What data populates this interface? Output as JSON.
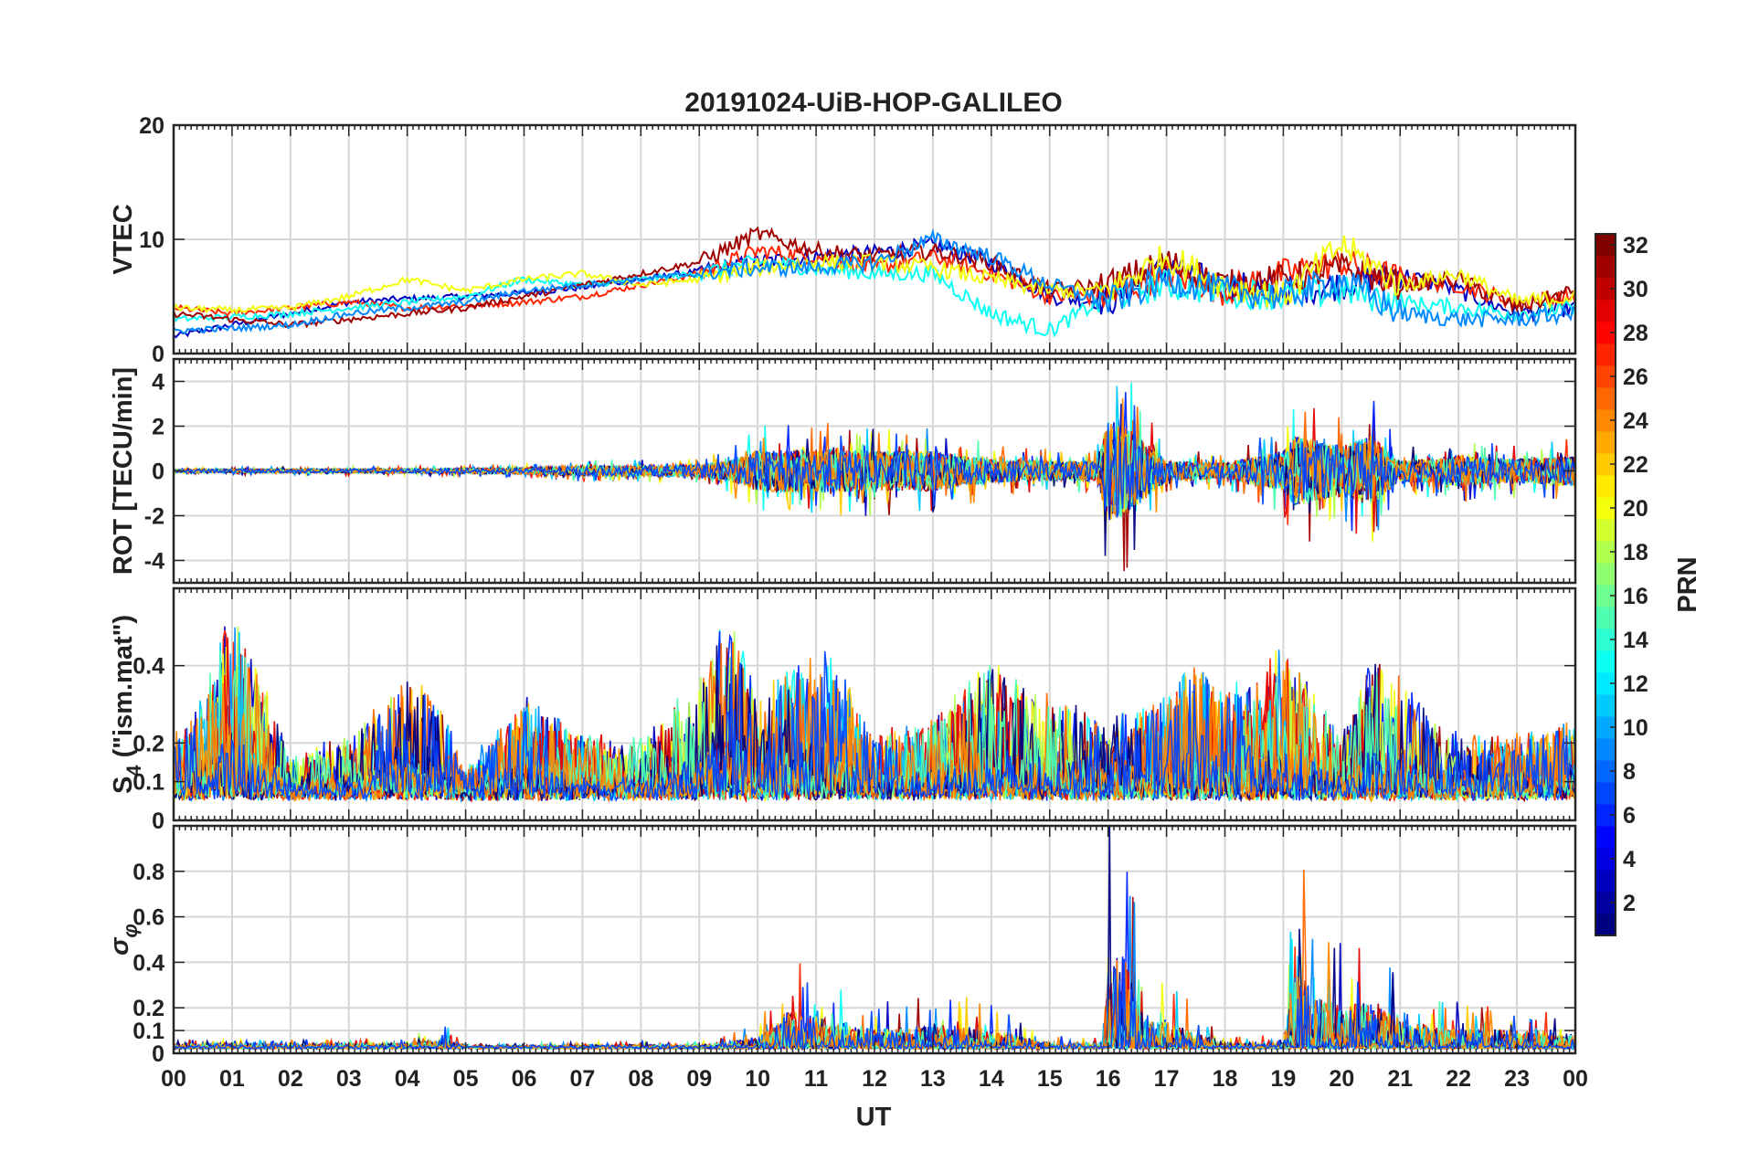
{
  "chart_data": {
    "type": "line",
    "title": "20191024-UiB-HOP-GALILEO",
    "xlabel": "UT",
    "x_ticks": [
      "00",
      "01",
      "02",
      "03",
      "04",
      "05",
      "06",
      "07",
      "08",
      "09",
      "10",
      "11",
      "12",
      "13",
      "14",
      "15",
      "16",
      "17",
      "18",
      "19",
      "20",
      "21",
      "22",
      "23",
      "00"
    ],
    "xlim_hours": [
      0,
      24
    ],
    "grid": true,
    "colorbar": {
      "label": "PRN",
      "range": [
        1,
        32
      ],
      "ticks": [
        "2",
        "4",
        "6",
        "8",
        "10",
        "12",
        "14",
        "16",
        "18",
        "20",
        "22",
        "24",
        "26",
        "28",
        "30",
        "32"
      ],
      "colormap": "jet"
    },
    "panels": [
      {
        "id": "vtec",
        "ylabel": "VTEC",
        "ylim": [
          0,
          20
        ],
        "yticks": [
          "0",
          "10",
          "20"
        ],
        "series": [
          {
            "prn": 3,
            "hours": [
              0,
              1,
              2,
              3,
              4,
              5,
              6,
              7,
              8,
              9,
              10,
              11,
              12,
              13,
              14,
              15,
              16,
              17,
              18,
              19,
              20,
              21,
              22,
              23,
              24
            ],
            "values": [
              1.5,
              2.5,
              3.5,
              4.5,
              4.8,
              5.0,
              5.3,
              5.8,
              6.5,
              7.2,
              8.0,
              8.5,
              8.8,
              9.5,
              8.0,
              5.0,
              4.5,
              7.5,
              6.0,
              5.5,
              6.0,
              7.0,
              5.5,
              3.5,
              4.0
            ]
          },
          {
            "prn": 27,
            "hours": [
              0,
              1,
              2,
              3,
              4,
              5,
              6,
              7,
              8,
              9,
              10,
              11,
              12,
              13,
              14,
              15,
              16,
              17,
              18,
              19,
              20,
              21,
              22,
              23,
              24
            ],
            "values": [
              4.0,
              3.5,
              4.0,
              4.5,
              4.0,
              4.2,
              4.5,
              5.0,
              6.0,
              7.0,
              9.0,
              8.5,
              7.5,
              8.5,
              7.0,
              5.0,
              5.0,
              7.0,
              5.5,
              7.0,
              8.0,
              6.5,
              6.0,
              4.5,
              5.0
            ]
          },
          {
            "prn": 13,
            "hours": [
              0,
              1,
              2,
              3,
              4,
              5,
              6,
              7,
              8,
              9,
              10,
              11,
              12,
              13,
              14,
              15,
              16,
              17,
              18,
              19,
              20,
              21,
              22,
              23,
              24
            ],
            "values": [
              3.0,
              3.2,
              3.5,
              4.0,
              4.5,
              5.0,
              6.5,
              6.0,
              6.5,
              7.0,
              8.0,
              7.5,
              7.0,
              7.0,
              3.5,
              2.0,
              5.0,
              6.0,
              5.5,
              5.0,
              5.5,
              4.5,
              4.0,
              3.5,
              4.0
            ]
          },
          {
            "prn": 31,
            "hours": [
              0,
              1,
              2,
              3,
              4,
              5,
              6,
              7,
              8,
              9,
              10,
              11,
              12,
              13,
              14,
              15,
              16,
              17,
              18,
              19,
              20,
              21,
              22,
              23,
              24
            ],
            "values": [
              3.5,
              3.0,
              2.5,
              3.0,
              3.5,
              4.0,
              5.0,
              6.0,
              7.0,
              8.0,
              10.5,
              9.0,
              8.5,
              9.0,
              8.0,
              5.5,
              6.0,
              8.0,
              6.0,
              6.5,
              7.5,
              6.0,
              6.5,
              4.0,
              5.5
            ]
          },
          {
            "prn": 20,
            "hours": [
              0,
              1,
              2,
              3,
              4,
              5,
              6,
              7,
              8,
              9,
              10,
              11,
              12,
              13,
              14,
              15,
              16,
              17,
              18,
              19,
              20,
              21,
              22,
              23,
              24
            ],
            "values": [
              4.0,
              3.8,
              4.0,
              5.0,
              6.5,
              5.5,
              6.5,
              7.0,
              6.0,
              6.5,
              7.5,
              8.0,
              8.0,
              7.5,
              6.5,
              5.5,
              5.5,
              8.5,
              6.0,
              5.0,
              9.5,
              6.0,
              7.0,
              4.5,
              5.0
            ]
          },
          {
            "prn": 9,
            "hours": [
              0,
              1,
              2,
              3,
              4,
              5,
              6,
              7,
              8,
              9,
              10,
              11,
              12,
              13,
              14,
              15,
              16,
              17,
              18,
              19,
              20,
              21,
              22,
              23,
              24
            ],
            "values": [
              2.0,
              2.2,
              2.5,
              3.5,
              4.0,
              4.5,
              5.5,
              6.0,
              6.5,
              7.0,
              7.5,
              7.5,
              8.0,
              10.0,
              8.5,
              6.0,
              4.5,
              6.5,
              5.5,
              5.0,
              6.5,
              3.5,
              3.0,
              3.0,
              3.5
            ]
          }
        ]
      },
      {
        "id": "rot",
        "ylabel": "ROT [TECU/min]",
        "ylim": [
          -5,
          5
        ],
        "yticks": [
          "-4",
          "-2",
          "0",
          "2",
          "4"
        ],
        "envelope": {
          "hours": [
            0,
            2,
            4,
            6,
            7,
            8,
            9,
            9.5,
            10,
            11,
            12,
            13,
            14,
            15,
            15.8,
            16,
            16.3,
            16.6,
            17,
            18,
            19,
            19.2,
            20,
            20.5,
            21,
            22,
            23,
            24
          ],
          "amplitude": [
            0.15,
            0.2,
            0.2,
            0.3,
            0.5,
            0.5,
            0.6,
            1.0,
            2.0,
            2.2,
            2.0,
            2.0,
            1.2,
            1.0,
            1.0,
            5.0,
            4.5,
            3.0,
            1.0,
            0.8,
            2.0,
            3.5,
            2.5,
            3.5,
            1.0,
            1.5,
            1.2,
            1.5
          ]
        }
      },
      {
        "id": "s4",
        "ylabel": "S4 (\"ism.mat\")",
        "ylim": [
          0,
          0.6
        ],
        "yticks": [
          "0",
          "0.1",
          "0.2",
          "0.4"
        ],
        "envelope": {
          "hours": [
            0,
            0.5,
            1,
            1.5,
            2,
            3,
            4,
            4.5,
            5,
            6,
            7,
            8,
            9,
            9.5,
            10,
            11,
            11.5,
            12,
            13,
            14,
            15,
            16,
            17,
            17.5,
            18,
            19,
            20,
            20.5,
            21,
            22,
            23,
            24
          ],
          "amplitude": [
            0.2,
            0.3,
            0.55,
            0.35,
            0.15,
            0.2,
            0.35,
            0.3,
            0.12,
            0.3,
            0.2,
            0.2,
            0.35,
            0.55,
            0.3,
            0.45,
            0.35,
            0.2,
            0.25,
            0.4,
            0.3,
            0.25,
            0.3,
            0.4,
            0.3,
            0.45,
            0.2,
            0.4,
            0.35,
            0.2,
            0.2,
            0.25
          ]
        }
      },
      {
        "id": "sigma_phi",
        "ylabel": "σφ",
        "ylim": [
          0,
          1
        ],
        "yticks": [
          "0",
          "0.1",
          "0.2",
          "0.4",
          "0.6",
          "0.8"
        ],
        "envelope": {
          "hours": [
            0,
            2,
            4,
            4.7,
            5,
            9,
            10,
            10.5,
            11,
            12,
            13,
            14,
            15,
            15.9,
            16,
            16.3,
            16.6,
            17,
            18,
            19,
            19.2,
            19.5,
            20,
            20.5,
            21,
            22,
            23,
            24
          ],
          "amplitude": [
            0.04,
            0.04,
            0.05,
            0.1,
            0.02,
            0.03,
            0.1,
            0.4,
            0.35,
            0.2,
            0.25,
            0.2,
            0.05,
            0.05,
            1.0,
            1.0,
            0.3,
            0.3,
            0.05,
            0.05,
            1.0,
            0.6,
            0.45,
            0.55,
            0.3,
            0.2,
            0.2,
            0.15
          ]
        }
      }
    ]
  }
}
